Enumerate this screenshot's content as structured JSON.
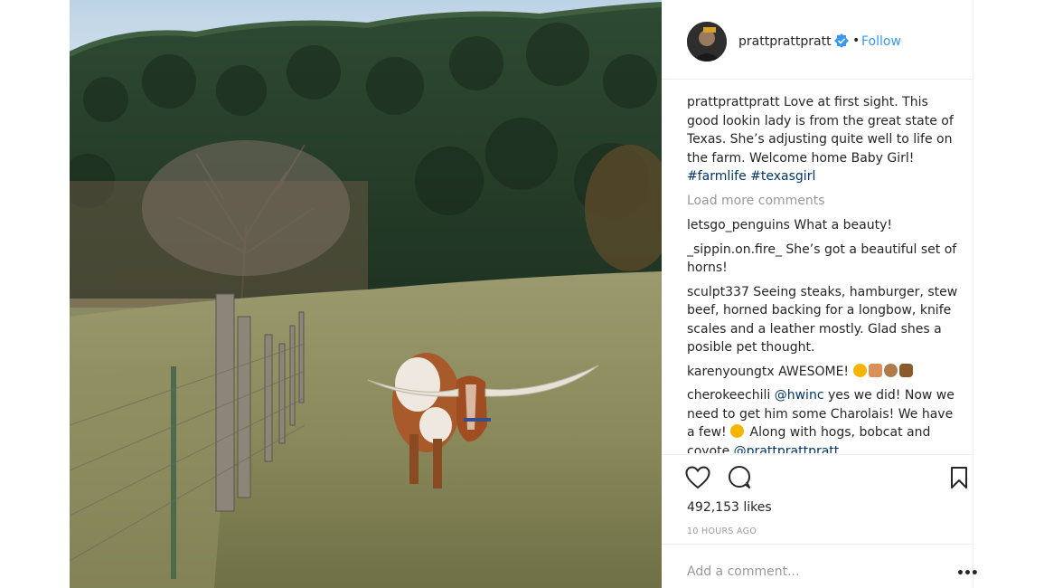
{
  "post": {
    "username": "prattprattpratt",
    "follow_label": "Follow",
    "separator": "•",
    "verified_icon": "verified-badge-icon",
    "accent_color": "#3897f0"
  },
  "caption": {
    "username": "prattprattpratt",
    "text": " Love at first sight. This good lookin lady is from the great state of Texas. She’s adjusting quite well to life on the farm. Welcome home Baby Girl! ",
    "hashtag1": "#farmlife",
    "hashtag2": "#texasgirl"
  },
  "load_more": "Load more comments",
  "comments": [
    {
      "user": "letsgo_penguins",
      "text": " What a beauty!"
    },
    {
      "user": "_sippin.on.fire_",
      "text": " She’s got a beautiful set of horns!"
    },
    {
      "user": "sculpt337",
      "text": " Seeing steaks, hamburger, stew beef, horned backing for a longbow, knife scales and a leather mostly. Glad shes a posible pet thought."
    },
    {
      "user": "karenyoungtx",
      "text": " AWESOME!"
    },
    {
      "user": "cherokeechili",
      "mention": "@hwinc",
      "text": " yes we did! Now we need to get him some Charolais! We have a few! ",
      "text2": " Along with hogs, bobcat and coyote ",
      "mention2": "@prattprattpratt"
    }
  ],
  "actions": {
    "like_icon": "heart-icon",
    "comment_icon": "comment-bubble-icon",
    "save_icon": "bookmark-icon"
  },
  "likes": "492,153 likes",
  "timestamp": "10 HOURS AGO",
  "add_comment": {
    "placeholder": "Add a comment..."
  },
  "more_label": "•••"
}
